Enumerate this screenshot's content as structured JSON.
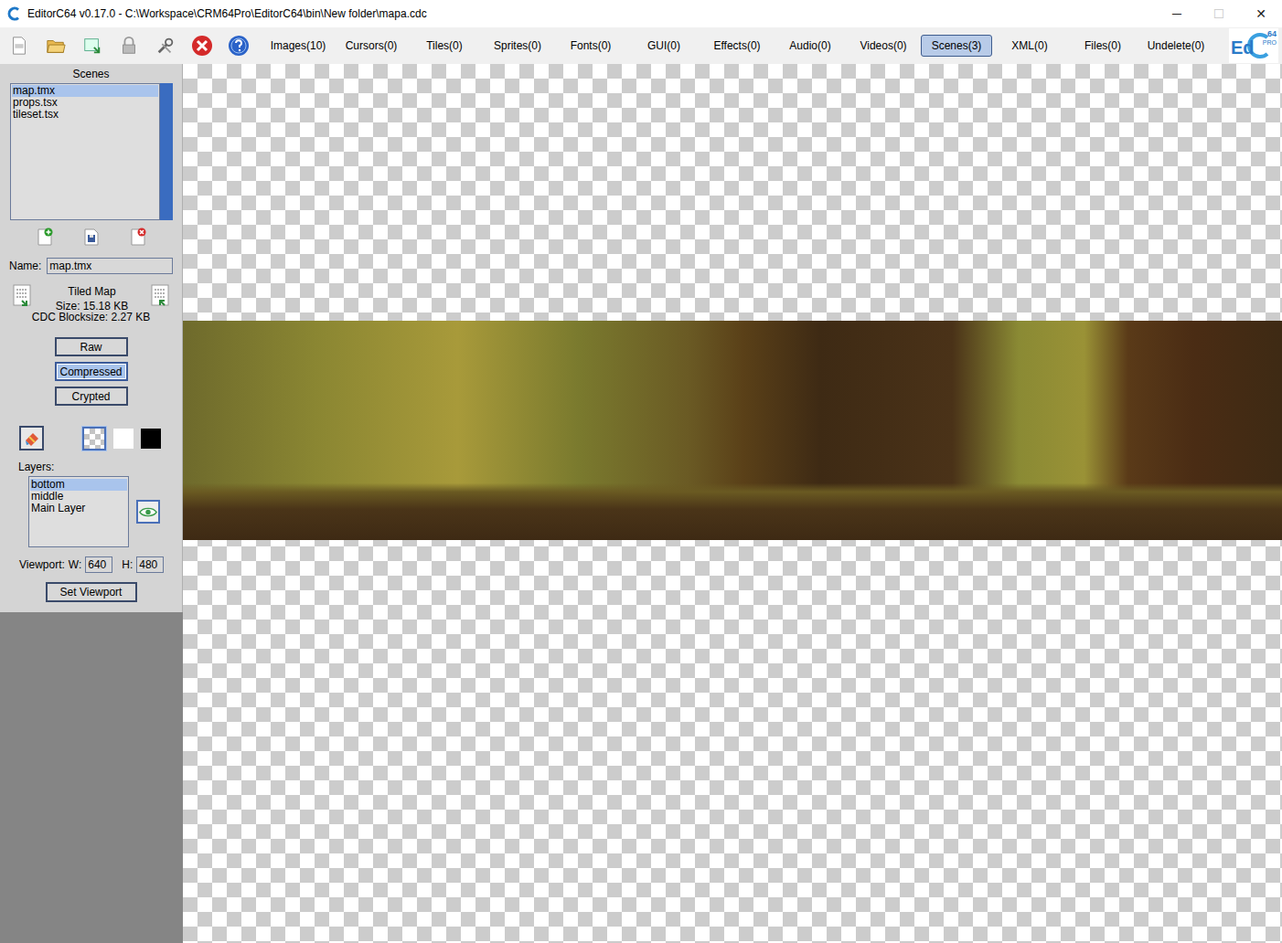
{
  "window": {
    "title": "EditorC64 v0.17.0 - C:\\Workspace\\CRM64Pro\\EditorC64\\bin\\New folder\\mapa.cdc",
    "controls": [
      {
        "glyph": "─",
        "disabled": false
      },
      {
        "glyph": "☐",
        "disabled": true
      },
      {
        "glyph": "✕",
        "disabled": false
      }
    ]
  },
  "toolbar": {
    "tabs": [
      {
        "label": "Images(10)",
        "selected": false
      },
      {
        "label": "Cursors(0)",
        "selected": false
      },
      {
        "label": "Tiles(0)",
        "selected": false
      },
      {
        "label": "Sprites(0)",
        "selected": false
      },
      {
        "label": "Fonts(0)",
        "selected": false
      },
      {
        "label": "GUI(0)",
        "selected": false
      },
      {
        "label": "Effects(0)",
        "selected": false
      },
      {
        "label": "Audio(0)",
        "selected": false
      },
      {
        "label": "Videos(0)",
        "selected": false
      },
      {
        "label": "Scenes(3)",
        "selected": true
      },
      {
        "label": "XML(0)",
        "selected": false
      },
      {
        "label": "Files(0)",
        "selected": false
      },
      {
        "label": "Undelete(0)",
        "selected": false
      }
    ],
    "logo": {
      "main": "Ed",
      "badge": "64",
      "sub": "PRO"
    }
  },
  "scenes_panel": {
    "title": "Scenes",
    "items": [
      {
        "label": "map.tmx",
        "selected": true
      },
      {
        "label": "props.tsx",
        "selected": false
      },
      {
        "label": "tileset.tsx",
        "selected": false
      }
    ],
    "scrollbar": {
      "level": 1
    },
    "name_label": "Name:",
    "name_value": "map.tmx",
    "info": {
      "type": "Tiled Map",
      "size": "Size: 15.18 KB",
      "blocksize": "CDC Blocksize: 2.27 KB"
    },
    "storage_modes": [
      {
        "label": "Raw",
        "selected": false
      },
      {
        "label": "Compressed",
        "selected": true
      },
      {
        "label": "Crypted",
        "selected": false
      }
    ],
    "backgrounds": [
      {
        "kind": "picker",
        "selected": false,
        "color": "#e8e8e8"
      },
      {
        "kind": "checker",
        "selected": true,
        "color": "#cccccc"
      },
      {
        "kind": "solid",
        "selected": false,
        "color": "#ffffff"
      },
      {
        "kind": "solid",
        "selected": false,
        "color": "#000000"
      }
    ],
    "layers_label": "Layers:",
    "layers": [
      {
        "label": "bottom",
        "selected": true
      },
      {
        "label": "middle",
        "selected": false
      },
      {
        "label": "Main Layer",
        "selected": false
      }
    ],
    "layer_visible": true,
    "viewport": {
      "label": "Viewport:",
      "w_label": "W:",
      "w": "640",
      "h_label": "H:",
      "h": "480",
      "button": "Set Viewport"
    }
  }
}
